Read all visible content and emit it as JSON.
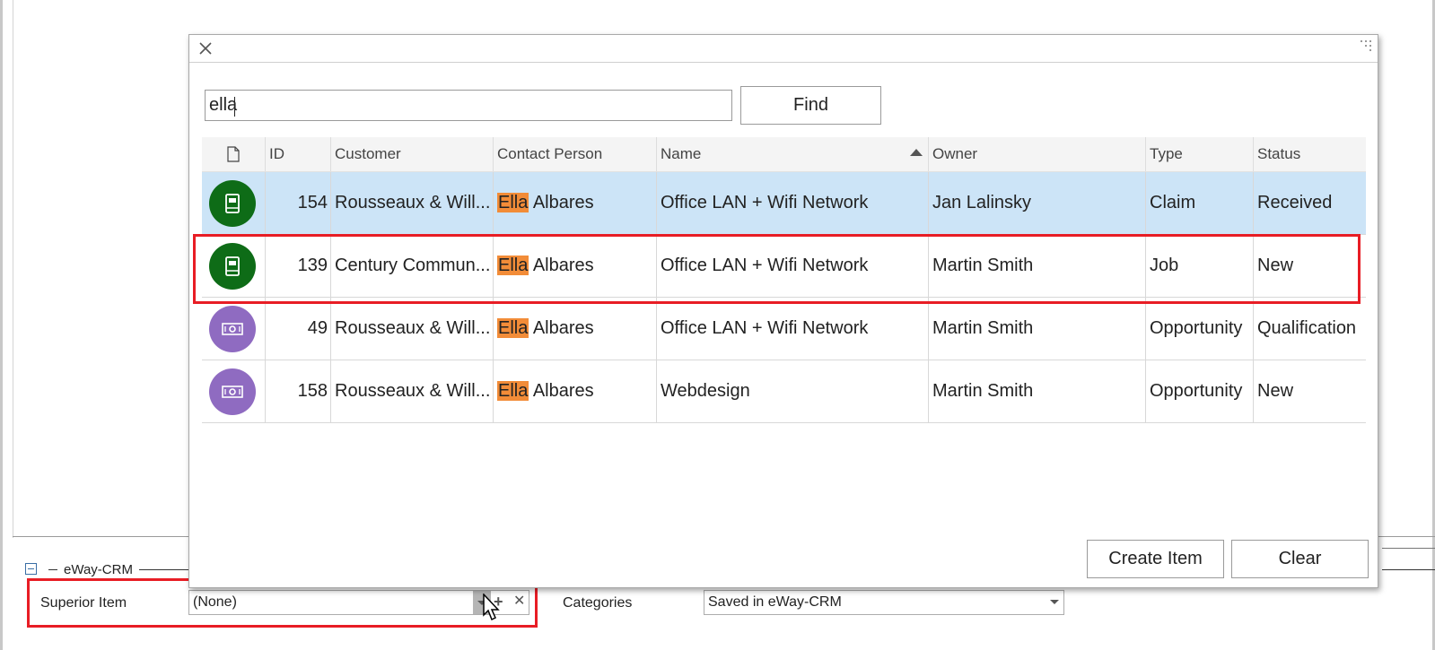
{
  "group": {
    "title": "eWay-CRM"
  },
  "form": {
    "superior_label": "Superior Item",
    "superior_value": "(None)",
    "categories_label": "Categories",
    "categories_value": "Saved in eWay-CRM"
  },
  "dialog": {
    "search_value": "ella",
    "find_label": "Find",
    "create_label": "Create Item",
    "clear_label": "Clear",
    "columns": [
      "ID",
      "Customer",
      "Contact Person",
      "Name",
      "Owner",
      "Type",
      "Status"
    ],
    "highlight_color": "#f28c38",
    "selected_row_color": "#cce4f7",
    "rows": [
      {
        "icon": "book-icon",
        "icon_color": "#0e6c17",
        "id": "154",
        "customer": "Rousseaux & Will...",
        "contact_hl": "Ella",
        "contact_rest": " Albares",
        "name": "Office LAN + Wifi Network",
        "owner": "Jan Lalinsky",
        "type": "Claim",
        "status": "Received"
      },
      {
        "icon": "book-icon",
        "icon_color": "#0e6c17",
        "id": "139",
        "customer": "Century Commun...",
        "contact_hl": "Ella",
        "contact_rest": " Albares",
        "name": "Office LAN + Wifi Network",
        "owner": "Martin Smith",
        "type": "Job",
        "status": "New"
      },
      {
        "icon": "money-icon",
        "icon_color": "#8f6bc1",
        "id": "49",
        "customer": "Rousseaux & Will...",
        "contact_hl": "Ella",
        "contact_rest": " Albares",
        "name": "Office LAN + Wifi Network",
        "owner": "Martin Smith",
        "type": "Opportunity",
        "status": "Qualification"
      },
      {
        "icon": "money-icon",
        "icon_color": "#8f6bc1",
        "id": "158",
        "customer": "Rousseaux & Will...",
        "contact_hl": "Ella",
        "contact_rest": " Albares",
        "name": "Webdesign",
        "owner": "Martin Smith",
        "type": "Opportunity",
        "status": "New"
      }
    ]
  }
}
